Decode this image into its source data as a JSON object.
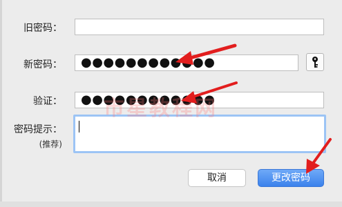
{
  "dialog": {
    "fields": {
      "old_password": {
        "label": "旧密码：",
        "value": ""
      },
      "new_password": {
        "label": "新密码：",
        "value": "●●●●●●●●●●●●"
      },
      "verify": {
        "label": "验证：",
        "value": "●●●●●●●●●●●●"
      },
      "hint": {
        "label": "密码提示：",
        "sublabel": "(推荐)",
        "value": ""
      }
    },
    "buttons": {
      "cancel": "取消",
      "change_password": "更改密码"
    },
    "watermark": "市星教程网"
  },
  "colors": {
    "arrow": "#e21e1e",
    "focus_ring": "#9cc4f5",
    "primary_button": "#3b82ec",
    "background": "#ececec"
  },
  "icons": {
    "password_assistant": "key-icon"
  }
}
